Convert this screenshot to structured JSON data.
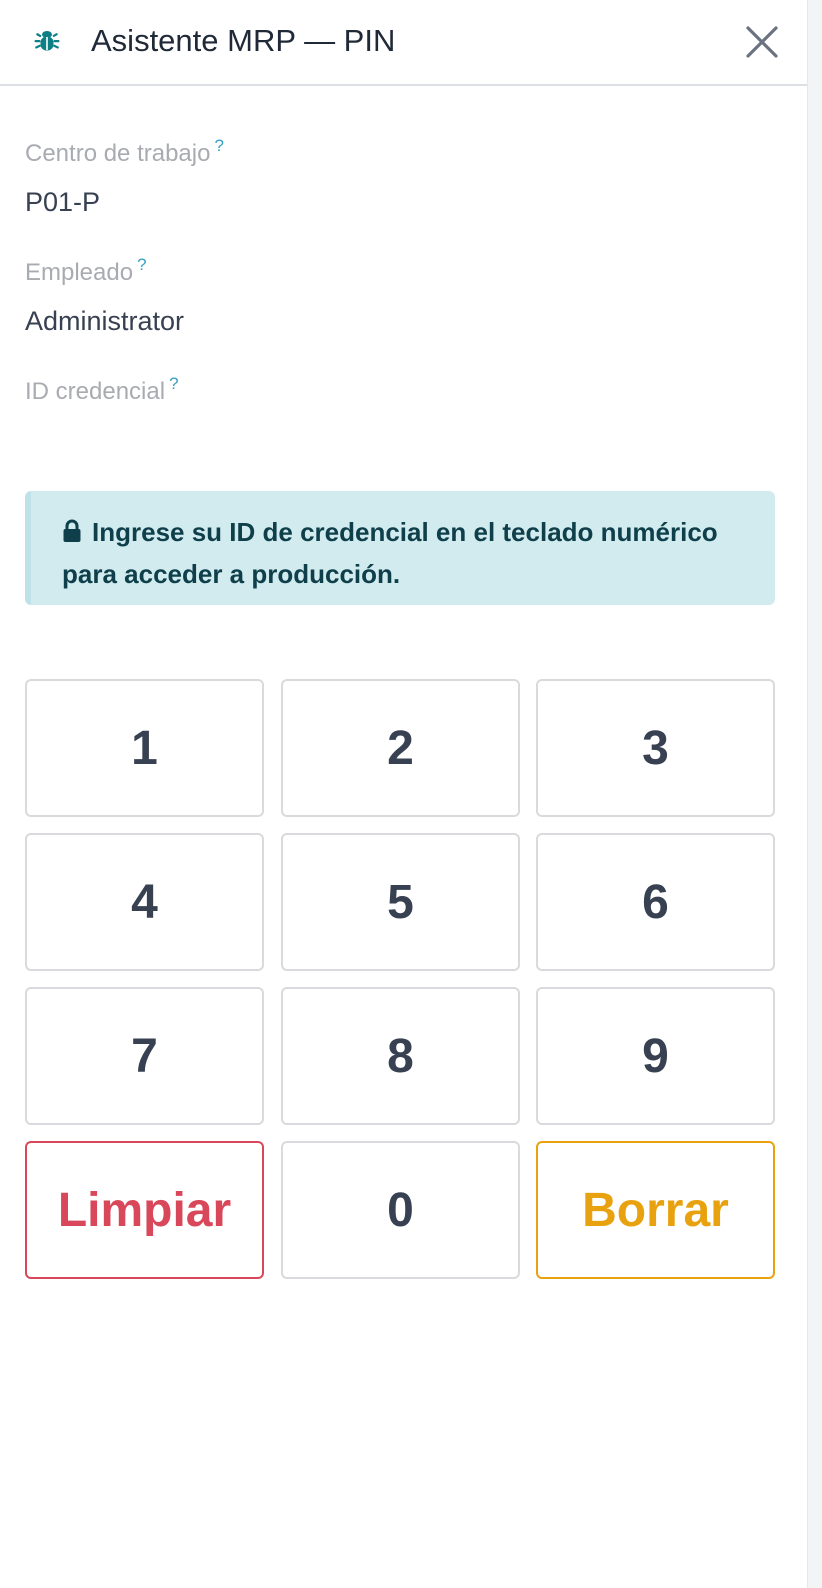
{
  "header": {
    "title": "Asistente MRP — PIN",
    "icon": "bug-icon",
    "close_icon": "close-icon"
  },
  "fields": {
    "workcenter": {
      "label": "Centro de trabajo",
      "help": "?",
      "value": "P01-P"
    },
    "employee": {
      "label": "Empleado",
      "help": "?",
      "value": "Administrator"
    },
    "badge": {
      "label": "ID credencial",
      "help": "?",
      "value": ""
    }
  },
  "alert": {
    "icon": "lock-icon",
    "text": "Ingrese su ID de credencial en el teclado numérico para acceder a producción."
  },
  "keypad": {
    "k1": "1",
    "k2": "2",
    "k3": "3",
    "k4": "4",
    "k5": "5",
    "k6": "6",
    "k7": "7",
    "k8": "8",
    "k9": "9",
    "clear": "Limpiar",
    "k0": "0",
    "backspace": "Borrar"
  },
  "colors": {
    "accent": "#0f7f86",
    "clear": "#d9485a",
    "backspace": "#e9a20f",
    "alert_bg": "#d1ebef",
    "alert_text": "#0e3f4a"
  }
}
